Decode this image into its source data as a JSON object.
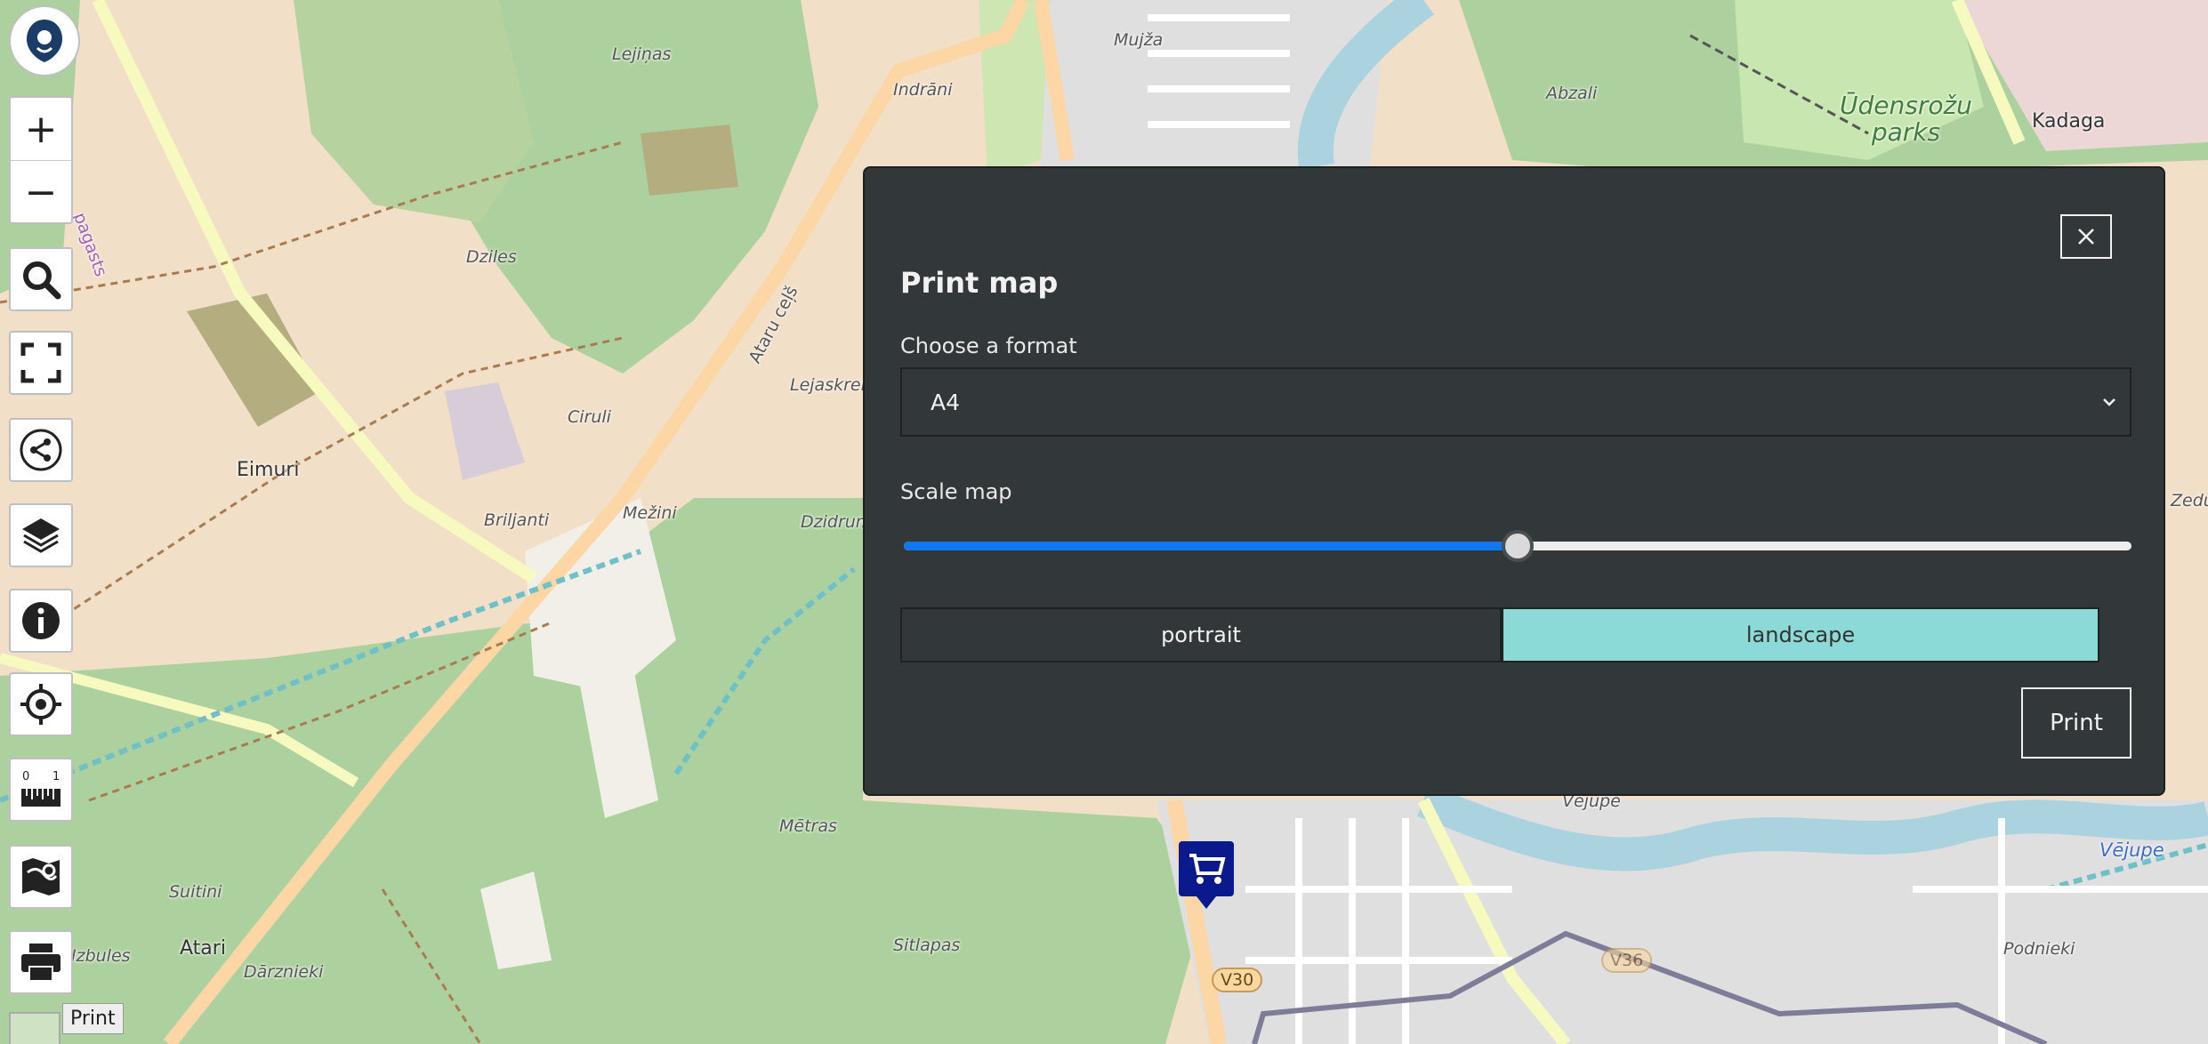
{
  "map": {
    "labels": [
      {
        "text": "Eimuri"
      },
      {
        "text": "Dziles"
      },
      {
        "text": "Lejiņas"
      },
      {
        "text": "Indrāni"
      },
      {
        "text": "Ciruli"
      },
      {
        "text": "Briljanti"
      },
      {
        "text": "Mežini"
      },
      {
        "text": "Lejaskrei"
      },
      {
        "text": "Dzidrum"
      },
      {
        "text": "Ataru ceļš"
      },
      {
        "text": "Mētras"
      },
      {
        "text": "Suitini"
      },
      {
        "text": "Atari"
      },
      {
        "text": "Izbules"
      },
      {
        "text": "Dārznieki"
      },
      {
        "text": "Sitlapas"
      },
      {
        "text": "Mujža"
      },
      {
        "text": "Abzali"
      },
      {
        "text": "Kadaga"
      },
      {
        "text": "Vējupe"
      },
      {
        "text": "Vējupe"
      },
      {
        "text": "Podnieki"
      },
      {
        "text": "Zedu"
      },
      {
        "text": "pagasts"
      }
    ],
    "park_label": [
      "Ūdensrožu",
      "parks"
    ],
    "road_shields": [
      "V30",
      "V36"
    ]
  },
  "toolbar": {
    "zoom_in": "+",
    "zoom_out": "−",
    "tools": [
      {
        "name": "search-icon"
      },
      {
        "name": "fullscreen-icon"
      },
      {
        "name": "share-icon"
      },
      {
        "name": "layers-icon"
      },
      {
        "name": "info-icon"
      },
      {
        "name": "locate-icon"
      },
      {
        "name": "measure-icon"
      },
      {
        "name": "map-style-icon"
      },
      {
        "name": "print-icon"
      }
    ],
    "tooltip": "Print"
  },
  "print_dialog": {
    "title": "Print map",
    "format_label": "Choose a format",
    "format_value": "A4",
    "scale_label": "Scale map",
    "scale_fraction": 0.5,
    "orientation": {
      "portrait": "portrait",
      "landscape": "landscape",
      "selected": "landscape"
    },
    "print_button": "Print",
    "close_symbol": "×"
  },
  "colors": {
    "dialog_bg": "#323839",
    "accent": "#8cdad8",
    "slider": "#1177ee",
    "marker": "#0a1a8c"
  }
}
